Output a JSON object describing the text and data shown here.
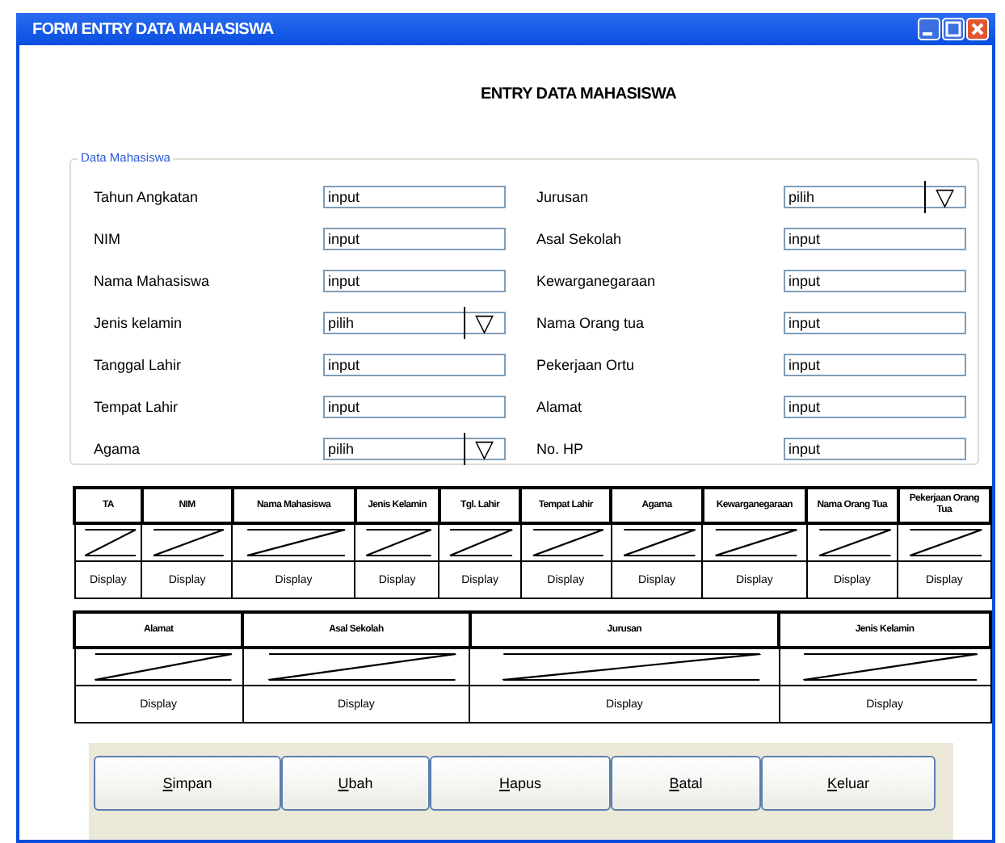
{
  "window": {
    "title": "FORM ENTRY DATA MAHASISWA"
  },
  "heading": "ENTRY DATA MAHASISWA",
  "group": {
    "title": "Data Mahasiswa",
    "left": [
      {
        "label": "Tahun Angkatan",
        "kind": "input",
        "value": "input"
      },
      {
        "label": "NIM",
        "kind": "input",
        "value": "input"
      },
      {
        "label": "Nama Mahasiswa",
        "kind": "input",
        "value": "input"
      },
      {
        "label": "Jenis kelamin",
        "kind": "select",
        "value": "pilih",
        "arrow": "▽"
      },
      {
        "label": "Tanggal Lahir",
        "kind": "input",
        "value": "input"
      },
      {
        "label": "Tempat Lahir",
        "kind": "input",
        "value": "input"
      },
      {
        "label": "Agama",
        "kind": "select",
        "value": "pilih",
        "arrow": "▽"
      }
    ],
    "right": [
      {
        "label": "Jurusan",
        "kind": "select",
        "value": "pilih",
        "arrow": "▽"
      },
      {
        "label": "Asal Sekolah",
        "kind": "input",
        "value": "input"
      },
      {
        "label": "Kewarganegaraan",
        "kind": "input",
        "value": "input"
      },
      {
        "label": "Nama Orang tua",
        "kind": "input",
        "value": "input"
      },
      {
        "label": "Pekerjaan Ortu",
        "kind": "input",
        "value": "input"
      },
      {
        "label": "Alamat",
        "kind": "input",
        "value": "input"
      },
      {
        "label": "No. HP",
        "kind": "input",
        "value": "input"
      }
    ]
  },
  "tables": [
    {
      "columns": [
        {
          "heading": "TA",
          "cell": "Display"
        },
        {
          "heading": "NIM",
          "cell": "Display"
        },
        {
          "heading": "Nama Mahasiswa",
          "cell": "Display"
        },
        {
          "heading": "Jenis Kelamin",
          "cell": "Display"
        },
        {
          "heading": "Tgl. Lahir",
          "cell": "Display"
        },
        {
          "heading": "Tempat Lahir",
          "cell": "Display"
        },
        {
          "heading": "Agama",
          "cell": "Display"
        },
        {
          "heading": "Kewarganegaraan",
          "cell": "Display"
        },
        {
          "heading": "Nama Orang Tua",
          "cell": "Display"
        },
        {
          "heading": "Pekerjaan Orang Tua",
          "cell": "Display"
        }
      ]
    },
    {
      "columns": [
        {
          "heading": "Alamat",
          "cell": "Display"
        },
        {
          "heading": "Asal Sekolah",
          "cell": "Display"
        },
        {
          "heading": "Jurusan",
          "cell": "Display"
        },
        {
          "heading": "Jenis Kelamin",
          "cell": "Display"
        }
      ]
    }
  ],
  "buttons": [
    "Simpan",
    "Ubah",
    "Hapus",
    "Batal",
    "Keluar"
  ]
}
